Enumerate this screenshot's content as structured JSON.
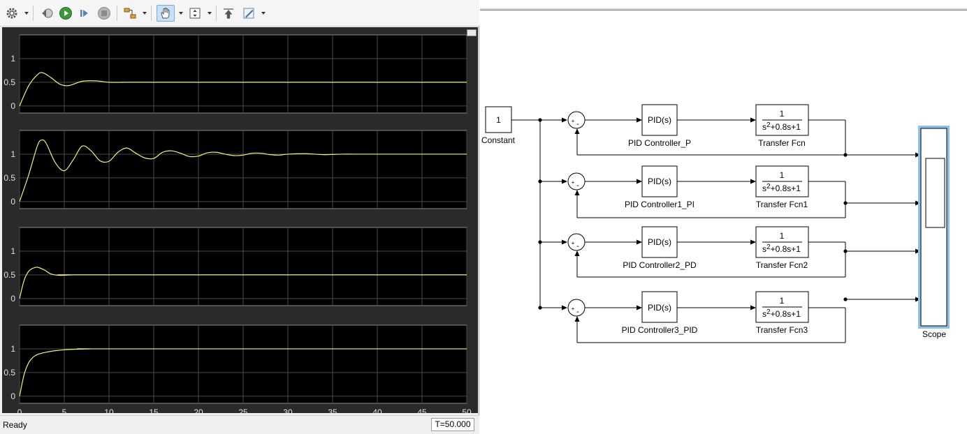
{
  "toolbar": {
    "items": [
      "settings",
      "step-back",
      "run",
      "step-forward",
      "stop",
      "highlight-block",
      "pan",
      "zoom",
      "restore",
      "edit"
    ]
  },
  "scope": {
    "status": "Ready",
    "time": "T=50.000",
    "trace_color": "#f5f07a",
    "background": "#000000",
    "frame_color": "#2a2a2a"
  },
  "chart_data": [
    {
      "type": "line",
      "title": "",
      "xlim": [
        0,
        50
      ],
      "ylim": [
        -0.15,
        1.5
      ],
      "yticks": [
        "0",
        "0.5",
        "1"
      ],
      "grid": true,
      "series": [
        {
          "system": "PID Controller_P",
          "x": [
            0,
            1,
            2,
            2.6,
            3.5,
            4.5,
            5.5,
            7,
            8.5,
            10,
            12,
            15,
            50
          ],
          "values": [
            0,
            0.42,
            0.66,
            0.7,
            0.6,
            0.46,
            0.43,
            0.52,
            0.53,
            0.5,
            0.5,
            0.5,
            0.5
          ]
        }
      ]
    },
    {
      "type": "line",
      "title": "",
      "xlim": [
        0,
        50
      ],
      "ylim": [
        -0.15,
        1.5
      ],
      "yticks": [
        "0",
        "0.5",
        "1"
      ],
      "grid": true,
      "series": [
        {
          "system": "PID Controller1_PI",
          "x": [
            0,
            1,
            2,
            2.5,
            3,
            4,
            5,
            6,
            7,
            8,
            9,
            10,
            11,
            12,
            13,
            14,
            15,
            16,
            17,
            18,
            19,
            20,
            21,
            22,
            23,
            24,
            25,
            26,
            27,
            28,
            29,
            30,
            32,
            34,
            36,
            38,
            40,
            45,
            50
          ],
          "values": [
            0,
            0.55,
            1.18,
            1.3,
            1.22,
            0.82,
            0.65,
            0.88,
            1.17,
            1.07,
            0.86,
            0.85,
            1.04,
            1.13,
            1.02,
            0.92,
            0.91,
            1.04,
            1.07,
            1.02,
            0.95,
            0.96,
            1.03,
            1.04,
            1.0,
            0.97,
            0.98,
            1.02,
            1.02,
            0.99,
            0.98,
            1.0,
            1.01,
            0.99,
            1.0,
            1.0,
            1.0,
            1.0,
            1.0
          ]
        }
      ]
    },
    {
      "type": "line",
      "title": "",
      "xlim": [
        0,
        50
      ],
      "ylim": [
        -0.15,
        1.5
      ],
      "yticks": [
        "0",
        "0.5",
        "1"
      ],
      "grid": true,
      "series": [
        {
          "system": "PID Controller2_PD",
          "x": [
            0,
            0.5,
            1,
            1.5,
            2,
            2.8,
            3.5,
            4.5,
            6,
            8,
            50
          ],
          "values": [
            0,
            0.38,
            0.57,
            0.64,
            0.66,
            0.6,
            0.52,
            0.49,
            0.5,
            0.5,
            0.5
          ]
        }
      ]
    },
    {
      "type": "line",
      "title": "",
      "xlim": [
        0,
        50
      ],
      "ylim": [
        -0.15,
        1.5
      ],
      "yticks": [
        "0",
        "0.5",
        "1"
      ],
      "xticks": [
        "0",
        "5",
        "10",
        "15",
        "20",
        "25",
        "30",
        "35",
        "40",
        "45",
        "50"
      ],
      "grid": true,
      "series": [
        {
          "system": "PID Controller3_PID",
          "x": [
            0,
            0.5,
            1,
            1.5,
            2,
            3,
            4,
            5,
            6,
            8,
            10,
            50
          ],
          "values": [
            0,
            0.45,
            0.7,
            0.82,
            0.88,
            0.93,
            0.96,
            0.98,
            0.99,
            1.0,
            1.0,
            1.0
          ]
        }
      ]
    }
  ],
  "diagram": {
    "constant": {
      "value": "1",
      "label": "Constant"
    },
    "sum_signs": {
      "plus": "+",
      "minus": "-"
    },
    "rows": [
      {
        "pid_text": "PID(s)",
        "pid_label": "PID Controller_P",
        "tf_num": "1",
        "tf_den_s": "s",
        "tf_den_exp": "2",
        "tf_den_rest": "+0.8s+1",
        "tf_label": "Transfer Fcn"
      },
      {
        "pid_text": "PID(s)",
        "pid_label": "PID Controller1_PI",
        "tf_num": "1",
        "tf_den_s": "s",
        "tf_den_exp": "2",
        "tf_den_rest": "+0.8s+1",
        "tf_label": "Transfer Fcn1"
      },
      {
        "pid_text": "PID(s)",
        "pid_label": "PID Controller2_PD",
        "tf_num": "1",
        "tf_den_s": "s",
        "tf_den_exp": "2",
        "tf_den_rest": "+0.8s+1",
        "tf_label": "Transfer Fcn2"
      },
      {
        "pid_text": "PID(s)",
        "pid_label": "PID Controller3_PID",
        "tf_num": "1",
        "tf_den_s": "s",
        "tf_den_exp": "2",
        "tf_den_rest": "+0.8s+1",
        "tf_label": "Transfer Fcn3"
      }
    ],
    "scope_label": "Scope",
    "scope_highlight": "#8ec0ea"
  }
}
